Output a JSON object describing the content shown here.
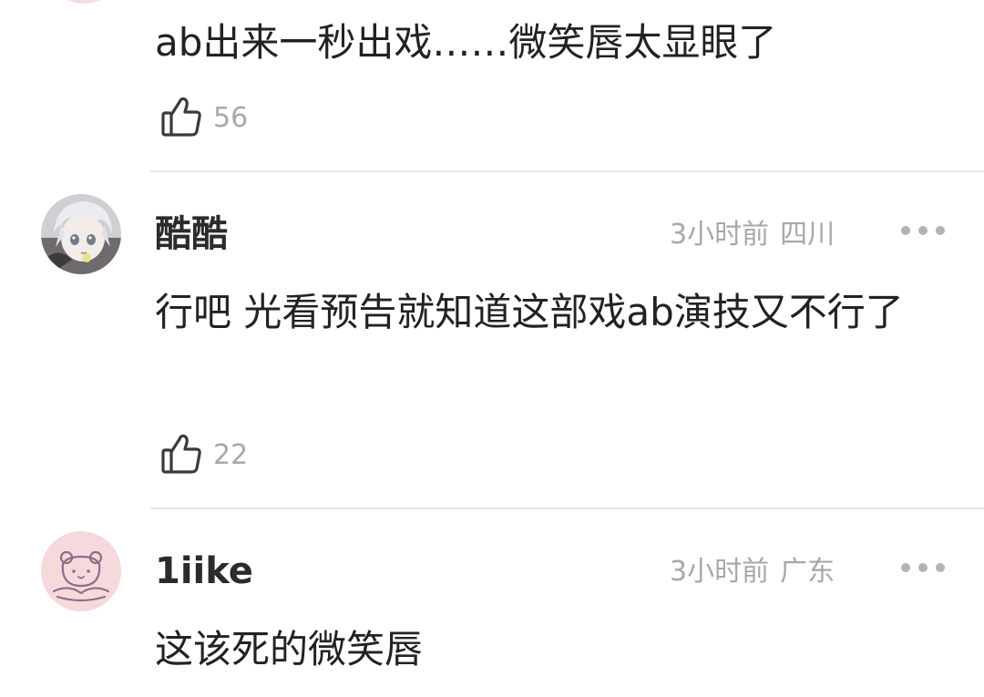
{
  "comments": [
    {
      "text": "ab出来一秒出戏……微笑唇太显眼了",
      "likes": "56",
      "like_icon": "thumbs-up-icon"
    },
    {
      "username": "酷酷",
      "time": "3小时前",
      "location": "四川",
      "text": "行吧 光看预告就知道这部戏ab演技又不行了",
      "likes": "22",
      "avatar_icon": "anime-avatar-icon",
      "like_icon": "thumbs-up-icon",
      "more_icon": "more-dots-icon"
    },
    {
      "username": "1iike",
      "time": "3小时前",
      "location": "广东",
      "text": "这该死的微笑唇",
      "avatar_icon": "bear-avatar-icon",
      "more_icon": "more-dots-icon"
    }
  ],
  "colors": {
    "text": "#222222",
    "meta": "#a8a8a8",
    "divider": "#e6e6e6",
    "bear_avatar_bg": "#f6d9dc",
    "bear_line": "#8a6f8a"
  }
}
